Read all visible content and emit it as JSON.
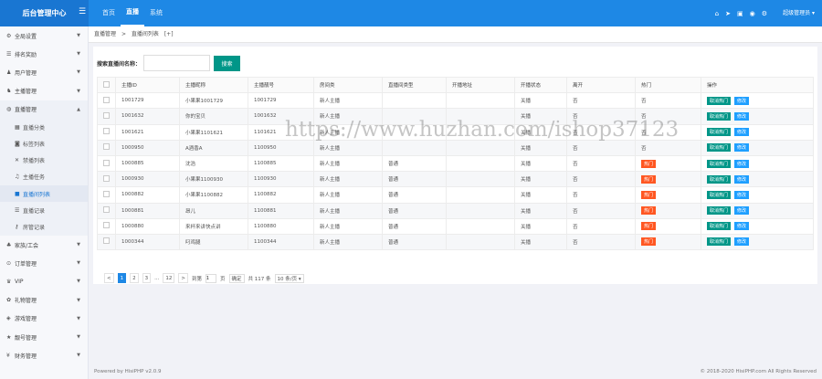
{
  "header": {
    "brand": "后台管理中心",
    "nav": [
      {
        "label": "首页"
      },
      {
        "label": "直播"
      },
      {
        "label": "系统"
      }
    ],
    "user": "超级管理员 ▾"
  },
  "sidebar": {
    "items": [
      {
        "label": "全局设置",
        "icon": "gear-icon"
      },
      {
        "label": "排名奖励",
        "icon": "list-icon"
      },
      {
        "label": "用户管理",
        "icon": "user-icon"
      },
      {
        "label": "主播管理",
        "icon": "users-icon"
      },
      {
        "label": "直播管理",
        "icon": "video-icon"
      }
    ],
    "subitems": [
      {
        "label": "直播分类",
        "icon": "grid-icon"
      },
      {
        "label": "标签列表",
        "icon": "tag-icon"
      },
      {
        "label": "禁播列表",
        "icon": "x-icon"
      },
      {
        "label": "主播任务",
        "icon": "task-icon"
      },
      {
        "label": "直播间列表",
        "icon": "camera-icon"
      },
      {
        "label": "直播记录",
        "icon": "list-icon"
      },
      {
        "label": "房管记录",
        "icon": "key-icon"
      }
    ],
    "items2": [
      {
        "label": "家族/工会",
        "icon": "group-icon"
      },
      {
        "label": "订单管理",
        "icon": "order-icon"
      },
      {
        "label": "VIP",
        "icon": "vip-icon"
      },
      {
        "label": "礼物管理",
        "icon": "gift-icon"
      },
      {
        "label": "游戏管理",
        "icon": "game-icon"
      },
      {
        "label": "靓号管理",
        "icon": "star-icon"
      },
      {
        "label": "财务管理",
        "icon": "money-icon"
      }
    ]
  },
  "breadcrumb": {
    "a": "直播管理",
    "sep": ">",
    "b": "直播间列表",
    "c": "[+]"
  },
  "search": {
    "label": "搜索直播间名称：",
    "value": "",
    "button": "搜索"
  },
  "table": {
    "headers": [
      "主播ID",
      "主播昵称",
      "主播靓号",
      "房间类",
      "直播间类型",
      "开播地址",
      "开播状态",
      "离开",
      "热门",
      "操作"
    ],
    "rows": [
      [
        "1001729",
        "小果果1001729",
        "1001729",
        "新人主播",
        "",
        "",
        "关播",
        "否",
        "否"
      ],
      [
        "1001632",
        "你的宝贝",
        "1001632",
        "新人主播",
        "",
        "",
        "关播",
        "否",
        "否"
      ],
      [
        "1001621",
        "小果果1101621",
        "1101621",
        "新人主播",
        "",
        "",
        "关播",
        "否",
        "否"
      ],
      [
        "1000950",
        "A酒香A",
        "1100950",
        "新人主播",
        "",
        "",
        "关播",
        "否",
        "否"
      ],
      [
        "1000885",
        "沈浩",
        "1100885",
        "新人主播",
        "普通",
        "",
        "关播",
        "否",
        "热门"
      ],
      [
        "1000930",
        "小果果1100930",
        "1100930",
        "新人主播",
        "普通",
        "",
        "关播",
        "否",
        "热门"
      ],
      [
        "1000882",
        "小果果1100882",
        "1100882",
        "新人主播",
        "普通",
        "",
        "关播",
        "否",
        "热门"
      ],
      [
        "1000881",
        "昂儿",
        "1100881",
        "新人主播",
        "普通",
        "",
        "关播",
        "否",
        "热门"
      ],
      [
        "1000880",
        "来杯来讲快点讲",
        "1100880",
        "新人主播",
        "普通",
        "",
        "关播",
        "否",
        "热门"
      ],
      [
        "1000344",
        "叼鸡腿",
        "1100344",
        "新人主播",
        "普通",
        "",
        "关播",
        "否",
        "热门"
      ]
    ],
    "op_primary": "取消热门",
    "op_secondary": "修改"
  },
  "pager": {
    "pages": [
      "1",
      "2",
      "3",
      "...",
      "12"
    ],
    "next": ">",
    "goto": "到第",
    "page": "1",
    "unit": "页",
    "confirm": "确定",
    "total": "共 117 条",
    "per_page": "10 条/页"
  },
  "footer": {
    "left": "Powered by HisiPHP v2.0.9",
    "right": "© 2018-2020 HisiPHP.com All Rights Reserved"
  },
  "watermark": "https://www.huzhan.com/ishop37123",
  "colors": {
    "topbar": "#1e88e5",
    "search_button": "#009688",
    "hot_badge": "#ff5722",
    "edit_button": "#1e9fff"
  }
}
